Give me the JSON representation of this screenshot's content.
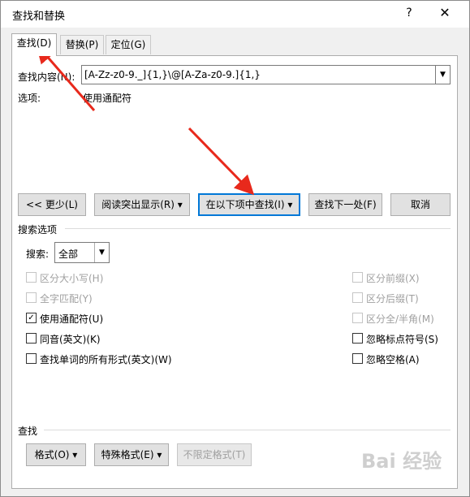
{
  "window": {
    "title": "查找和替换",
    "help": "?",
    "close": "✕"
  },
  "tabs": [
    {
      "label": "查找(D)",
      "active": true
    },
    {
      "label": "替换(P)",
      "active": false
    },
    {
      "label": "定位(G)",
      "active": false
    }
  ],
  "find": {
    "label": "查找内容(N):",
    "value": "[A-Zz-z0-9._]{1,}\\@[A-Za-z0-9.]{1,}",
    "options_label": "选项:",
    "options_value": "使用通配符"
  },
  "buttons": {
    "less": "<< 更少(L)",
    "reading_highlight": "阅读突出显示(R) ▾",
    "find_in": "在以下项中查找(I) ▾",
    "find_next": "查找下一处(F)",
    "cancel": "取消"
  },
  "search_options": {
    "header": "搜索选项",
    "search_label": "搜索:",
    "search_value": "全部",
    "left_checks": [
      {
        "label": "区分大小写(H)",
        "checked": false,
        "enabled": false
      },
      {
        "label": "全字匹配(Y)",
        "checked": false,
        "enabled": false
      },
      {
        "label": "使用通配符(U)",
        "checked": true,
        "enabled": true
      },
      {
        "label": "同音(英文)(K)",
        "checked": false,
        "enabled": true
      },
      {
        "label": "查找单词的所有形式(英文)(W)",
        "checked": false,
        "enabled": true
      }
    ],
    "right_checks": [
      {
        "label": "区分前缀(X)",
        "checked": false,
        "enabled": false
      },
      {
        "label": "区分后缀(T)",
        "checked": false,
        "enabled": false
      },
      {
        "label": "区分全/半角(M)",
        "checked": false,
        "enabled": false
      },
      {
        "label": "忽略标点符号(S)",
        "checked": false,
        "enabled": true
      },
      {
        "label": "忽略空格(A)",
        "checked": false,
        "enabled": true
      }
    ]
  },
  "find_section": {
    "header": "查找",
    "format": "格式(O) ▾",
    "special": "特殊格式(E) ▾",
    "no_format": "不限定格式(T)"
  },
  "watermark": "Bai 经验",
  "colors": {
    "accent": "#0078d7",
    "annotation_arrow": "#e8291c"
  }
}
